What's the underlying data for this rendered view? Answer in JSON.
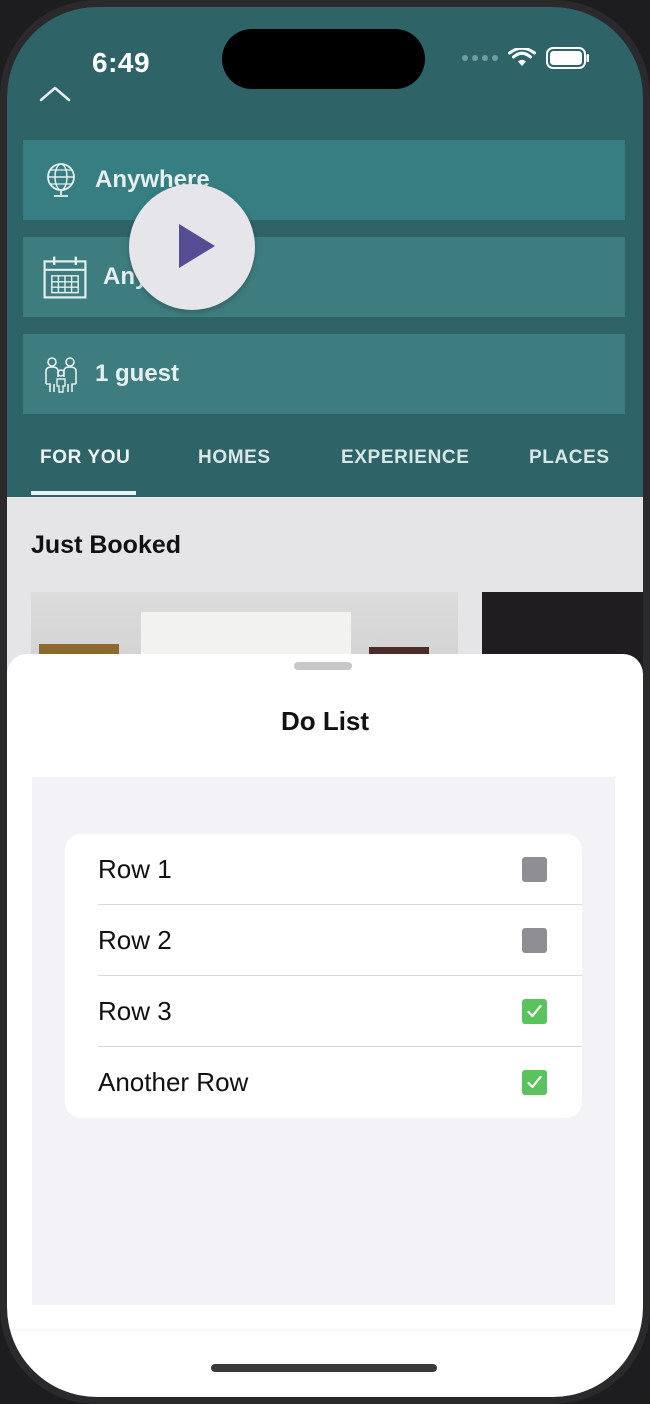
{
  "status": {
    "time": "6:49"
  },
  "search": {
    "where": "Anywhere",
    "when": "Anytime",
    "guests": "1 guest"
  },
  "tabs": [
    {
      "label": "FOR YOU",
      "selected": true
    },
    {
      "label": "HOMES",
      "selected": false
    },
    {
      "label": "EXPERIENCE",
      "selected": false
    },
    {
      "label": "PLACES",
      "selected": false
    }
  ],
  "feed": {
    "section_title": "Just Booked"
  },
  "sheet": {
    "title": "Do List",
    "rows": [
      {
        "label": "Row 1",
        "checked": false
      },
      {
        "label": "Row 2",
        "checked": false
      },
      {
        "label": "Row 3",
        "checked": true
      },
      {
        "label": "Another Row",
        "checked": true
      }
    ]
  },
  "colors": {
    "header_teal": "#2e6468",
    "check_green": "#5ac35d",
    "check_gray": "#8e8e93"
  }
}
